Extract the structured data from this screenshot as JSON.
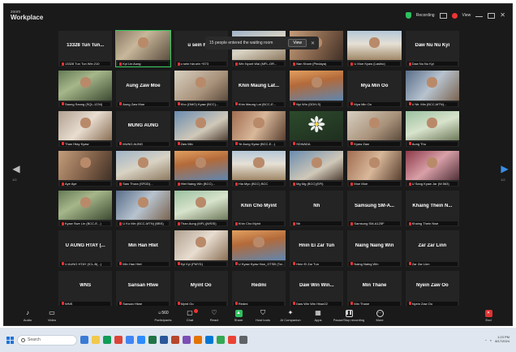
{
  "app": {
    "brand_small": "zoom",
    "brand_title": "Workplace"
  },
  "titlebar": {
    "status": "Recording",
    "view_label": "View"
  },
  "notification": {
    "text": "15 people entered the waiting room",
    "button": "View"
  },
  "grid": {
    "tiles": [
      {
        "name": "13328 Tun Tun...",
        "label": "13328 Tun Tun Win 210",
        "video": "",
        "active": false
      },
      {
        "name": "",
        "label": "Kyi Lin Aung",
        "video": "v1",
        "active": true
      },
      {
        "name": "u sein hla...",
        "label": "u sein hla win +573",
        "video": "",
        "active": false
      },
      {
        "name": "",
        "label": "Win Nyunt Wai (MFL-OR...",
        "video": "v2",
        "active": false
      },
      {
        "name": "",
        "label": "Nan Kham (Pindaya)",
        "video": "v3",
        "active": false
      },
      {
        "name": "",
        "label": "U Moe Kyaw (Lashio)",
        "video": "v4",
        "active": false
      },
      {
        "name": "Daw Nu Nu Kyi",
        "label": "Daw Nu Nu Kyi",
        "video": "",
        "active": false
      },
      {
        "name": "",
        "label": "Saung Saung (SQL-1234)",
        "video": "v5",
        "active": false
      },
      {
        "name": "Aung Zaw Moe",
        "label": "Aung Zaw Moe",
        "video": "",
        "active": false
      },
      {
        "name": "",
        "label": "Kho (DMO) Kyaw (BCC)...",
        "video": "v6",
        "active": false
      },
      {
        "name": "Khin Maung Lat...",
        "label": "Khin Maung Lat (BCC-E...",
        "video": "",
        "active": false
      },
      {
        "name": "",
        "label": "Nyi Win (DDH-S)",
        "video": "v7",
        "active": false
      },
      {
        "name": "Mya Min Oo",
        "label": "Mya Min Oo",
        "video": "",
        "active": false
      },
      {
        "name": "",
        "label": "U Mr. Min (BCC-MTN)...",
        "video": "v8",
        "active": false
      },
      {
        "name": "",
        "label": "Than Htay Kyaw",
        "video": "v10",
        "active": false
      },
      {
        "name": "MUNG AUNG",
        "label": "MUNG AUNG",
        "video": "",
        "active": false
      },
      {
        "name": "",
        "label": "Zaw Min",
        "video": "v11",
        "active": false
      },
      {
        "name": "",
        "label": "Ye Aung Kyaw (BCC-E...)",
        "video": "v12",
        "active": false
      },
      {
        "name": "",
        "label": "SDWADA",
        "video": "v9",
        "flower": true,
        "active": false
      },
      {
        "name": "",
        "label": "Kyaw Zaw",
        "video": "v6",
        "active": false
      },
      {
        "name": "",
        "label": "Aung Thu",
        "video": "v13",
        "active": false
      },
      {
        "name": "",
        "label": "Aye Aye",
        "video": "v3",
        "active": false
      },
      {
        "name": "",
        "label": "Saw Thura (SFDD)...",
        "video": "v2",
        "active": false
      },
      {
        "name": "",
        "label": "Htet Naing Win (BCC)...",
        "video": "v7",
        "active": false
      },
      {
        "name": "",
        "label": "Hla Myo (BCC) BCC",
        "video": "v4",
        "active": false
      },
      {
        "name": "",
        "label": "Mg Mg (BCC)(SFI)",
        "video": "v11",
        "active": false
      },
      {
        "name": "",
        "label": "Moe Moe",
        "video": "v12",
        "active": false
      },
      {
        "name": "",
        "label": "U Sang Kyaw Jar (W.563)",
        "video": "v14",
        "active": false
      },
      {
        "name": "",
        "label": "Kyaw Swe Lin (BCC-E...)",
        "video": "v5",
        "active": false
      },
      {
        "name": "",
        "label": "U Ko Min (BCC-MTN) (BBS)",
        "video": "v8",
        "active": false
      },
      {
        "name": "",
        "label": "Than Aung (MFL)(WSSI)",
        "video": "v13",
        "active": false
      },
      {
        "name": "Khin Cho Myint",
        "label": "Khin Cho Myint",
        "video": "",
        "active": false
      },
      {
        "name": "Nh",
        "label": "Nh",
        "video": "",
        "active": false
      },
      {
        "name": "Samsung SM-A...",
        "label": "Samsung SM-A125F",
        "video": "",
        "active": false
      },
      {
        "name": "Khaing Thein N...",
        "label": "Khaing Thein Nwe",
        "video": "",
        "active": false
      },
      {
        "name": "U AUNG HTAY (...",
        "label": "U AUNG HTAY (ICL-B(...)",
        "video": "",
        "active": false
      },
      {
        "name": "Min Han Htet",
        "label": "Min Han Htet",
        "video": "",
        "active": false
      },
      {
        "name": "",
        "label": "Kyi Kyi (FMYD)",
        "video": "v10",
        "active": false
      },
      {
        "name": "",
        "label": "U Kyaw Kyaw Han_GTSB (Tal...)",
        "video": "v7",
        "active": false
      },
      {
        "name": "Hnin Ei Zar Tun",
        "label": "Hnin Ei Zar Tun",
        "video": "",
        "active": false
      },
      {
        "name": "Naing Naing Win",
        "label": "Naing Naing Win",
        "video": "",
        "active": false
      },
      {
        "name": "Zar Zar Linn",
        "label": "Zar Zar Linn",
        "video": "",
        "active": false
      },
      {
        "name": "WNS",
        "label": "WNS",
        "video": "",
        "active": false
      },
      {
        "name": "Sansan Htwe",
        "label": "Sansan Htwe",
        "video": "",
        "active": false
      },
      {
        "name": "Myint Oo",
        "label": "Myint Oo",
        "video": "",
        "active": false
      },
      {
        "name": "Redmi",
        "label": "Redmi",
        "video": "",
        "active": false
      },
      {
        "name": "Daw Win Win...",
        "label": "Daw Win Win Htwe22",
        "video": "",
        "active": false
      },
      {
        "name": "Min Thane",
        "label": "Min Thane",
        "video": "",
        "active": false
      },
      {
        "name": "Nyein Zaw Oo",
        "label": "Nyein Zaw Oo",
        "video": "",
        "active": false
      }
    ]
  },
  "nav": {
    "prev_page": "1/2",
    "next_page": "1/2"
  },
  "toolbar": {
    "audio": "Audio",
    "video": "Video",
    "participants": "Participants",
    "participants_count": "560",
    "chat": "Chat",
    "react": "React",
    "share": "Share",
    "host_tools": "Host tools",
    "ai_companion": "AI Companion",
    "apps": "Apps",
    "pause_stop_recording": "Pause/Stop recording",
    "more": "More",
    "end": "End"
  },
  "taskbar": {
    "search_placeholder": "Search",
    "time": "1:23 PM",
    "date": "8/17/2024"
  },
  "colors": {
    "active_border": "#32c85a",
    "share_green": "#2fbf5f",
    "end_red": "#dd3333",
    "next_arrow": "#3a8ee6"
  }
}
